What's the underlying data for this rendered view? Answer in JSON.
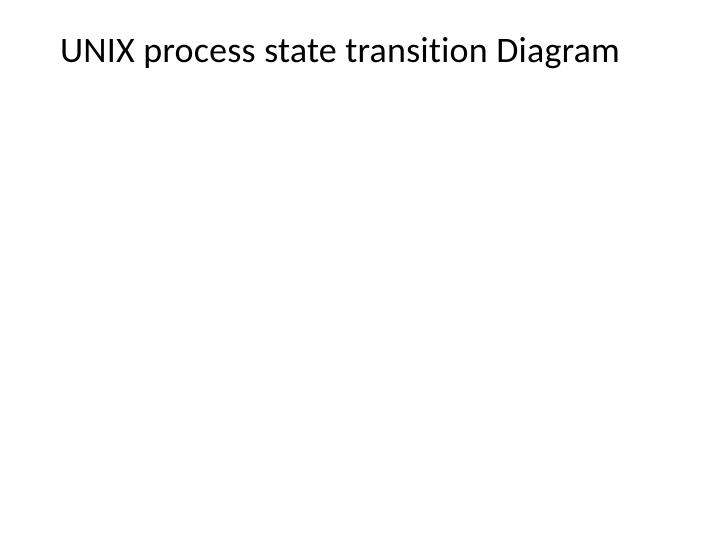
{
  "slide": {
    "title": "UNIX process state transition Diagram"
  }
}
